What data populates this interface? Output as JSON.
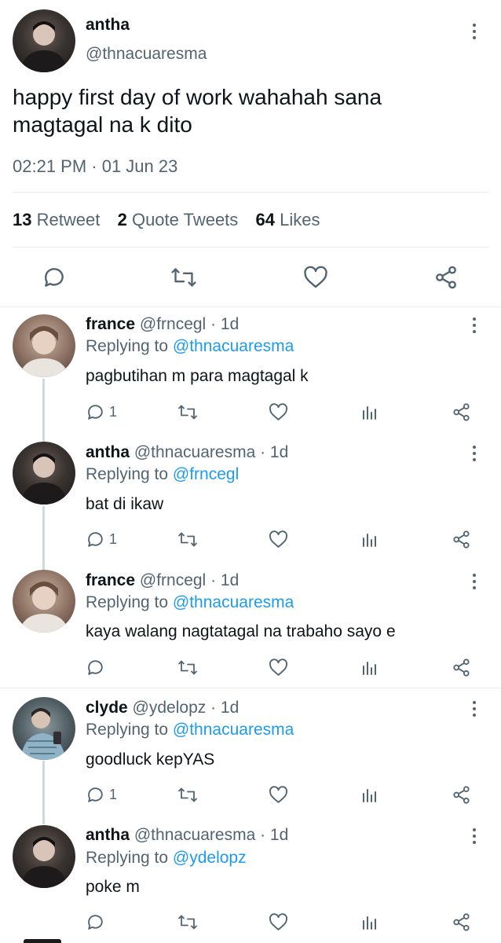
{
  "main_tweet": {
    "name": "antha",
    "handle": "@thnacuaresma",
    "text_line1": "happy first day of work wahahah sana",
    "text_line2": "magtagal na k dito",
    "timestamp": "02:21 PM · 01 Jun 23",
    "stats": {
      "retweets_count": "13",
      "retweets_label": "Retweet",
      "quotes_count": "2",
      "quotes_label": "Quote Tweets",
      "likes_count": "64",
      "likes_label": "Likes"
    }
  },
  "replies": [
    {
      "name": "france",
      "handle": "@frncegl",
      "time": "· 1d",
      "replying_prefix": "Replying to",
      "replying_to": "@thnacuaresma",
      "text": "pagbutihan m para magtagal k",
      "reply_count": "1"
    },
    {
      "name": "antha",
      "handle": "@thnacuaresma",
      "time": "· 1d",
      "replying_prefix": "Replying to",
      "replying_to": "@frncegl",
      "text": "bat di ikaw",
      "reply_count": "1"
    },
    {
      "name": "france",
      "handle": "@frncegl",
      "time": "· 1d",
      "replying_prefix": "Replying to",
      "replying_to": "@thnacuaresma",
      "text": "kaya walang nagtatagal na trabaho sayo e",
      "reply_count": ""
    },
    {
      "name": "clyde",
      "handle": "@ydelopz",
      "time": "· 1d",
      "replying_prefix": "Replying to",
      "replying_to": "@thnacuaresma",
      "text": "goodluck kepYAS",
      "reply_count": "1"
    },
    {
      "name": "antha",
      "handle": "@thnacuaresma",
      "time": "· 1d",
      "replying_prefix": "Replying to",
      "replying_to": "@ydelopz",
      "text": "poke m",
      "reply_count": ""
    }
  ],
  "icons": {
    "reply": "reply-icon",
    "retweet": "retweet-icon",
    "like": "heart-icon",
    "share": "share-icon",
    "views": "views-icon",
    "more": "more-icon"
  },
  "colors": {
    "link": "#1d9bf0",
    "muted": "#536471",
    "text": "#0f1419",
    "divider": "#e6ecf0"
  }
}
